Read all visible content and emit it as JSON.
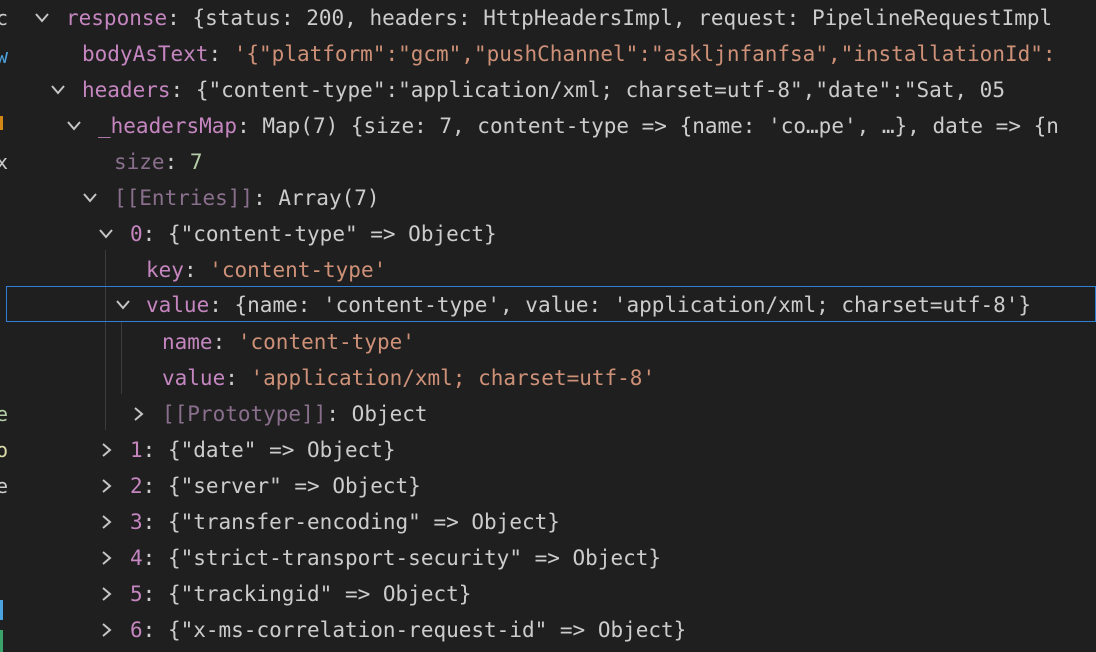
{
  "colors": {
    "background": "#1f1f1f",
    "key": "#c586c0",
    "string": "#ce9178",
    "number": "#b5cea8",
    "punctuation": "#cccccc",
    "selection_border": "#2f7fd8"
  },
  "gutter": {
    "chars": [
      "c",
      "w",
      "x",
      "e",
      "o",
      "e"
    ]
  },
  "tree": {
    "response": {
      "key": "response",
      "sep": ": ",
      "value": "{status: 200, headers: HttpHeadersImpl, request: PipelineRequestImpl"
    },
    "bodyAsText": {
      "key": "bodyAsText",
      "sep": ": ",
      "value": "'{\"platform\":\"gcm\",\"pushChannel\":\"askljnfanfsa\",\"installationId\":"
    },
    "headers": {
      "key": "headers",
      "sep": ": ",
      "value": "{\"content-type\":\"application/xml; charset=utf-8\",\"date\":\"Sat, 05"
    },
    "headersMap": {
      "key": "_headersMap",
      "sep": ": ",
      "value": "Map(7) {size: 7, content-type => {name: 'co…pe', …}, date => {n"
    },
    "size": {
      "key": "size",
      "sep": ": ",
      "value": "7"
    },
    "entries": {
      "key": "[[Entries]]",
      "sep": ": ",
      "value": "Array(7)"
    },
    "entry0": {
      "key": "0",
      "sep": ": ",
      "value": "{\"content-type\" => Object}",
      "key_row": {
        "key": "key",
        "sep": ": ",
        "value": "'content-type'"
      },
      "value_row": {
        "key": "value",
        "sep": ": ",
        "value": "{name: 'content-type', value: 'application/xml; charset=utf-8'}"
      },
      "name_row": {
        "key": "name",
        "sep": ": ",
        "value": "'content-type'"
      },
      "inner_value_row": {
        "key": "value",
        "sep": ": ",
        "value": "'application/xml; charset=utf-8'"
      },
      "prototype_row": {
        "key": "[[Prototype]]",
        "sep": ": ",
        "value": "Object"
      }
    },
    "collapsed_entries": [
      {
        "key": "1",
        "sep": ": ",
        "value": "{\"date\" => Object}"
      },
      {
        "key": "2",
        "sep": ": ",
        "value": "{\"server\" => Object}"
      },
      {
        "key": "3",
        "sep": ": ",
        "value": "{\"transfer-encoding\" => Object}"
      },
      {
        "key": "4",
        "sep": ": ",
        "value": "{\"strict-transport-security\" => Object}"
      },
      {
        "key": "5",
        "sep": ": ",
        "value": "{\"trackingid\" => Object}"
      },
      {
        "key": "6",
        "sep": ": ",
        "value": "{\"x-ms-correlation-request-id\" => Object}"
      }
    ]
  }
}
